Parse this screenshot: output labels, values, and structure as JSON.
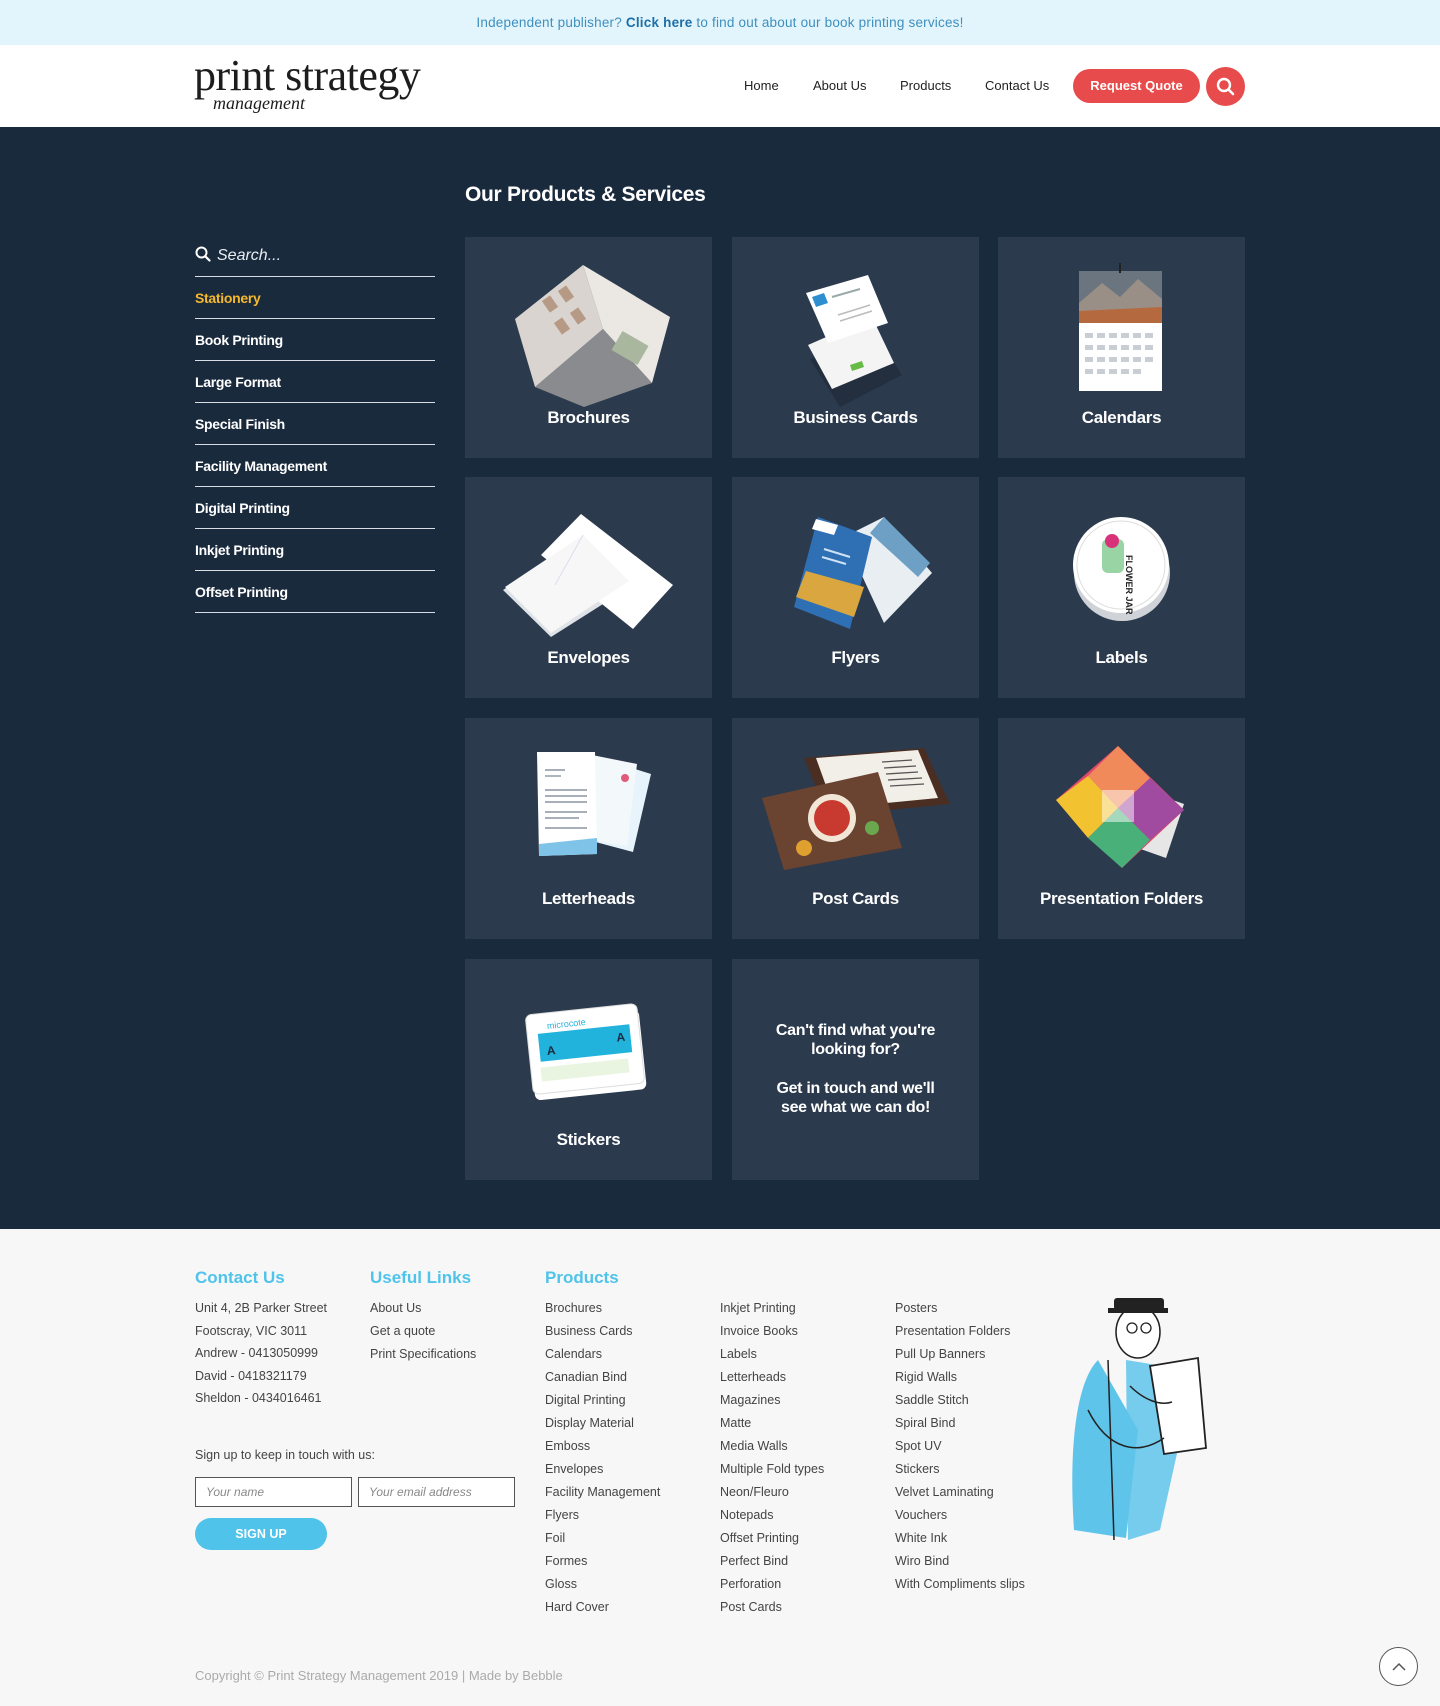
{
  "topbar": {
    "prefix": "Independent publisher?",
    "link": "Click here",
    "suffix": "to find out about our book printing services!"
  },
  "logo": {
    "line1": "print strategy",
    "line2": "management"
  },
  "nav": {
    "home": "Home",
    "about": "About Us",
    "products": "Products",
    "contact": "Contact Us",
    "quote": "Request Quote"
  },
  "section_title": "Our Products & Services",
  "sidebar": {
    "search_placeholder": "Search...",
    "items": [
      "Stationery",
      "Book Printing",
      "Large Format",
      "Special Finish",
      "Facility Management",
      "Digital Printing",
      "Inkjet Printing",
      "Offset Printing"
    ],
    "active": "Stationery"
  },
  "products": [
    "Brochures",
    "Business Cards",
    "Calendars",
    "Envelopes",
    "Flyers",
    "Labels",
    "Letterheads",
    "Post Cards",
    "Presentation Folders",
    "Stickers"
  ],
  "cta": {
    "line1": "Can't find what you're",
    "line2": "looking for?",
    "line3": "Get in touch and we'll",
    "line4": "see what we can do!"
  },
  "footer": {
    "contact_heading": "Contact Us",
    "contact": [
      "Unit 4, 2B Parker Street",
      "Footscray, VIC 3011",
      "Andrew - 0413050999",
      "David - 0418321179",
      "Sheldon - 0434016461"
    ],
    "links_heading": "Useful Links",
    "links": [
      "About Us",
      "Get a quote",
      "Print Specifications"
    ],
    "products_heading": "Products",
    "products_col1": [
      "Brochures",
      "Business Cards",
      "Calendars",
      "Canadian Bind",
      "Digital Printing",
      "Display Material",
      "Emboss",
      "Envelopes",
      "Facility Management",
      "Flyers",
      "Foil",
      "Formes",
      "Gloss",
      "Hard Cover"
    ],
    "products_col2": [
      "Inkjet Printing",
      "Invoice Books",
      "Labels",
      "Letterheads",
      "Magazines",
      "Matte",
      "Media Walls",
      "Multiple Fold types",
      "Neon/Fleuro",
      "Notepads",
      "Offset Printing",
      "Perfect Bind",
      "Perforation",
      "Post Cards"
    ],
    "products_col3": [
      "Posters",
      "Presentation Folders",
      "Pull Up Banners",
      "Rigid Walls",
      "Saddle Stitch",
      "Spiral Bind",
      "Spot UV",
      "Stickers",
      "Velvet Laminating",
      "Vouchers",
      "White Ink",
      "Wiro Bind",
      "With Compliments slips"
    ],
    "signup_text": "Sign up to keep in touch with us:",
    "name_placeholder": "Your name",
    "email_placeholder": "Your email address",
    "signup_button": "SIGN UP",
    "copyright": "Copyright © Print Strategy Management 2019 | Made by Bebble"
  },
  "colors": {
    "accent_red": "#e84b4b",
    "accent_blue": "#4fc3ea",
    "active_yellow": "#f5b82e",
    "dark_bg": "#1a2a3d",
    "card_bg": "#2b3a4d"
  },
  "icons": [
    "search-icon",
    "arrow-up-icon"
  ]
}
